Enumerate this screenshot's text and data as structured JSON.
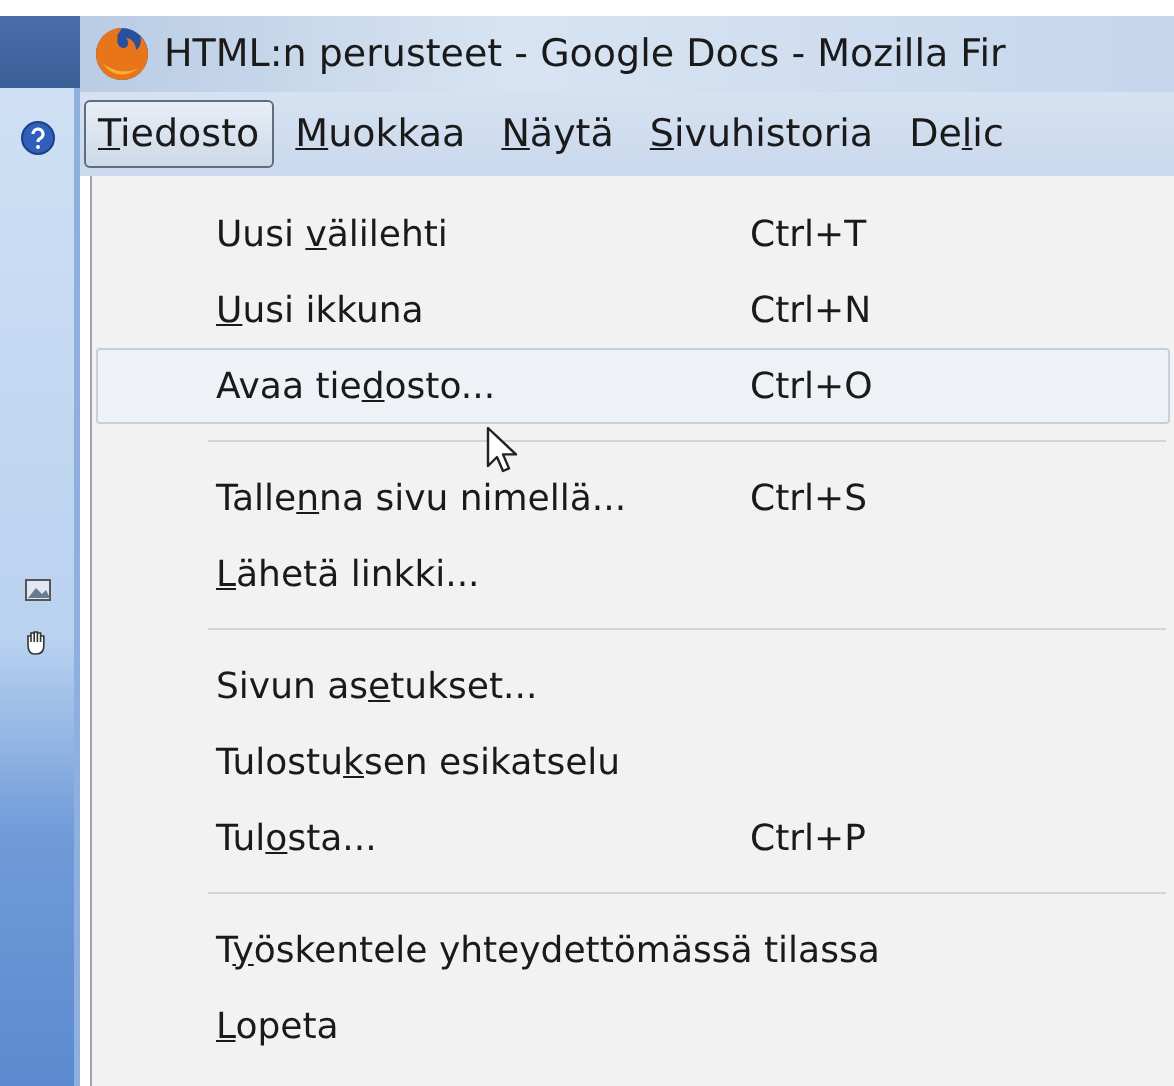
{
  "window": {
    "title": "HTML:n perusteet - Google Docs - Mozilla Fir"
  },
  "menu_bar": [
    {
      "key": "T",
      "after": "iedosto",
      "selected": true
    },
    {
      "key": "M",
      "after": "uokkaa",
      "selected": false
    },
    {
      "key": "N",
      "after": "äytä",
      "selected": false
    },
    {
      "key": "S",
      "after": "ivuhistoria",
      "selected": false
    },
    {
      "before": "De",
      "key": "l",
      "after": "ic",
      "selected": false
    }
  ],
  "menu": {
    "sections": [
      {
        "items": [
          {
            "before": "Uusi ",
            "key": "v",
            "after": "älilehti",
            "shortcut": "Ctrl+T",
            "highlighted": false
          },
          {
            "key": "U",
            "after": "usi ikkuna",
            "shortcut": "Ctrl+N",
            "highlighted": false
          },
          {
            "before": "Avaa tie",
            "key": "d",
            "after": "osto...",
            "shortcut": "Ctrl+O",
            "highlighted": true
          }
        ]
      },
      {
        "items": [
          {
            "before": "Talle",
            "key": "n",
            "after": "na sivu nimellä...",
            "shortcut": "Ctrl+S",
            "highlighted": false
          },
          {
            "key": "L",
            "after": "ähetä linkki...",
            "highlighted": false
          }
        ]
      },
      {
        "items": [
          {
            "before": "Sivun as",
            "key": "e",
            "after": "tukset...",
            "highlighted": false
          },
          {
            "before": "Tulostu",
            "key": "k",
            "after": "sen esikatselu",
            "highlighted": false
          },
          {
            "before": "Tul",
            "key": "o",
            "after": "sta...",
            "shortcut": "Ctrl+P",
            "highlighted": false
          }
        ]
      },
      {
        "items": [
          {
            "before": "T",
            "key": "y",
            "after": "öskentele yhteydettömässä tilassa",
            "highlighted": false
          },
          {
            "key": "L",
            "after": "opeta",
            "highlighted": false
          }
        ]
      }
    ]
  }
}
